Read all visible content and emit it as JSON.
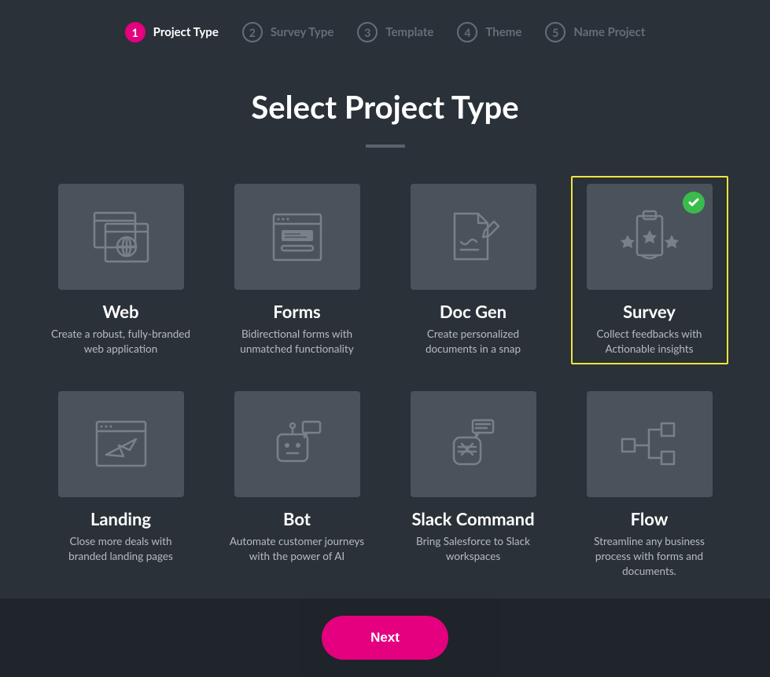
{
  "stepper": [
    {
      "num": "1",
      "label": "Project Type",
      "active": true
    },
    {
      "num": "2",
      "label": "Survey Type",
      "active": false
    },
    {
      "num": "3",
      "label": "Template",
      "active": false
    },
    {
      "num": "4",
      "label": "Theme",
      "active": false
    },
    {
      "num": "5",
      "label": "Name Project",
      "active": false
    }
  ],
  "heading": "Select Project Type",
  "cards": [
    {
      "title": "Web",
      "desc": "Create a robust, fully-branded web application",
      "icon": "web"
    },
    {
      "title": "Forms",
      "desc": "Bidirectional forms with unmatched functionality",
      "icon": "forms"
    },
    {
      "title": "Doc Gen",
      "desc": "Create personalized documents in a snap",
      "icon": "docgen"
    },
    {
      "title": "Survey",
      "desc": "Collect feedbacks with Actionable insights",
      "icon": "survey",
      "selected": true
    },
    {
      "title": "Landing",
      "desc": "Close more deals with branded landing pages",
      "icon": "landing"
    },
    {
      "title": "Bot",
      "desc": "Automate customer journeys with the power of AI",
      "icon": "bot"
    },
    {
      "title": "Slack Command",
      "desc": "Bring Salesforce to Slack workspaces",
      "icon": "slack"
    },
    {
      "title": "Flow",
      "desc": "Streamline any business process with forms and documents.",
      "icon": "flow"
    }
  ],
  "footer": {
    "next_label": "Next"
  }
}
